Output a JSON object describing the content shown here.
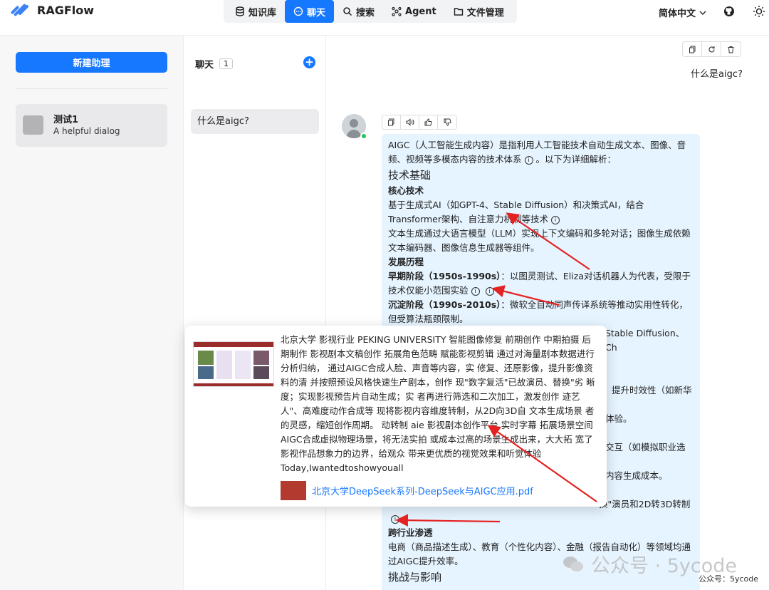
{
  "app": {
    "name": "RAGFlow"
  },
  "nav": {
    "items": [
      {
        "label": "知识库",
        "icon": "database-icon"
      },
      {
        "label": "聊天",
        "icon": "chat-icon",
        "active": true
      },
      {
        "label": "搜索",
        "icon": "search-icon"
      },
      {
        "label": "Agent",
        "icon": "agent-icon"
      },
      {
        "label": "文件管理",
        "icon": "folder-icon"
      }
    ]
  },
  "header": {
    "language": "简体中文"
  },
  "sidebar": {
    "new_button": "新建助理",
    "assistants": [
      {
        "name": "测试1",
        "description": "A helpful dialog"
      }
    ]
  },
  "chats": {
    "title": "聊天",
    "count": "1",
    "items": [
      {
        "label": "什么是aigc?"
      }
    ]
  },
  "conversation": {
    "user_question": "什么是aigc?",
    "answer": {
      "intro": "AIGC（人工智能生成内容）是指利用人工智能技术自动生成文本、图像、音频、视频等多模态内容的技术体系",
      "intro_tail": "。以下为详细解析：",
      "sec1_title": "技术基础",
      "core_title": "核心技术",
      "core_text": "基于生成式AI（如GPT-4、Stable Diffusion）和决策式AI，结合Transformer架构、自注意力机制等技术",
      "core_text2": "文本生成通过大语言模型（LLM）实现上下文编码和多轮对话；图像生成依赖文本编码器、图像信息生成器等组件。",
      "history_title": "发展历程",
      "early_label": "早期阶段（1950s-1990s）",
      "early_text": "：以图灵测试、Eliza对话机器人为代表，受限于技术仅能小范围实验",
      "mid_label": "沉淀阶段（1990s-2010s）",
      "mid_text": "：微软全自动同声传译系统等推动实用性转化，但受算法瓶颈限制。",
      "frag1": "Stable Diffusion、Ch",
      "frag2": "提升时效性（如新华",
      "frag3": "体验。",
      "frag4": "交互（如模拟职业选",
      "frag5": "内容生成成本。",
      "frag6": "换\"演员和2D转3D转制",
      "cross_title": "跨行业渗透",
      "cross_text": "电商（商品描述生成）、教育（个性化内容）、金融（报告自动化）等领域均通过AIGC提升效率。",
      "challenge_title": "挑战与影响"
    },
    "tool_icons": [
      "copy-icon",
      "speaker-icon",
      "thumbs-up-icon",
      "thumbs-down-icon"
    ]
  },
  "citation_popup": {
    "text": "北京大学 影视行业 PEKING UNIVERSITY 智能图像修复 前期创作 中期拍摄 后期制作 影视剧本文稿创作 拓展角色范畴 赋能影视剪辑 通过对海量剧本数据进行分析归纳， 通过AIGC合成人脸、声音等内容，实 修复、还原影像，提升影像资料的清 并按照预设风格快速生产剧本，创作 现\"数字复活\"已故演员、替换\"劣 晰度；实现影视预告片自动生成；实 者再进行筛选和二次加工，激发创作 迹艺人\"、高难度动作合成等 现将影视内容维度转制，从2D向3D自 文本生成场景 者的灵感，缩短创作周期。 动转制 aie 影视剧本创作平台 实时字幕 拓展场景空间 AIGC合成虚拟物理场景，将无法实拍 或成本过高的场景生成出来，大大拓 宽了影视作品想象力的边界，给观众 带来更优质的视觉效果和听觉体验",
    "tail": "Today,Iwantedtoshowyouall",
    "doc_name": "北京大学DeepSeek系列-DeepSeek与AIGC应用.pdf"
  },
  "watermark": {
    "big": "公众号 · 5ycode",
    "small": "公众号：5ycode"
  },
  "colors": {
    "accent": "#1677ff",
    "answer_bg": "#e6f4ff",
    "arrow": "#e52222"
  }
}
